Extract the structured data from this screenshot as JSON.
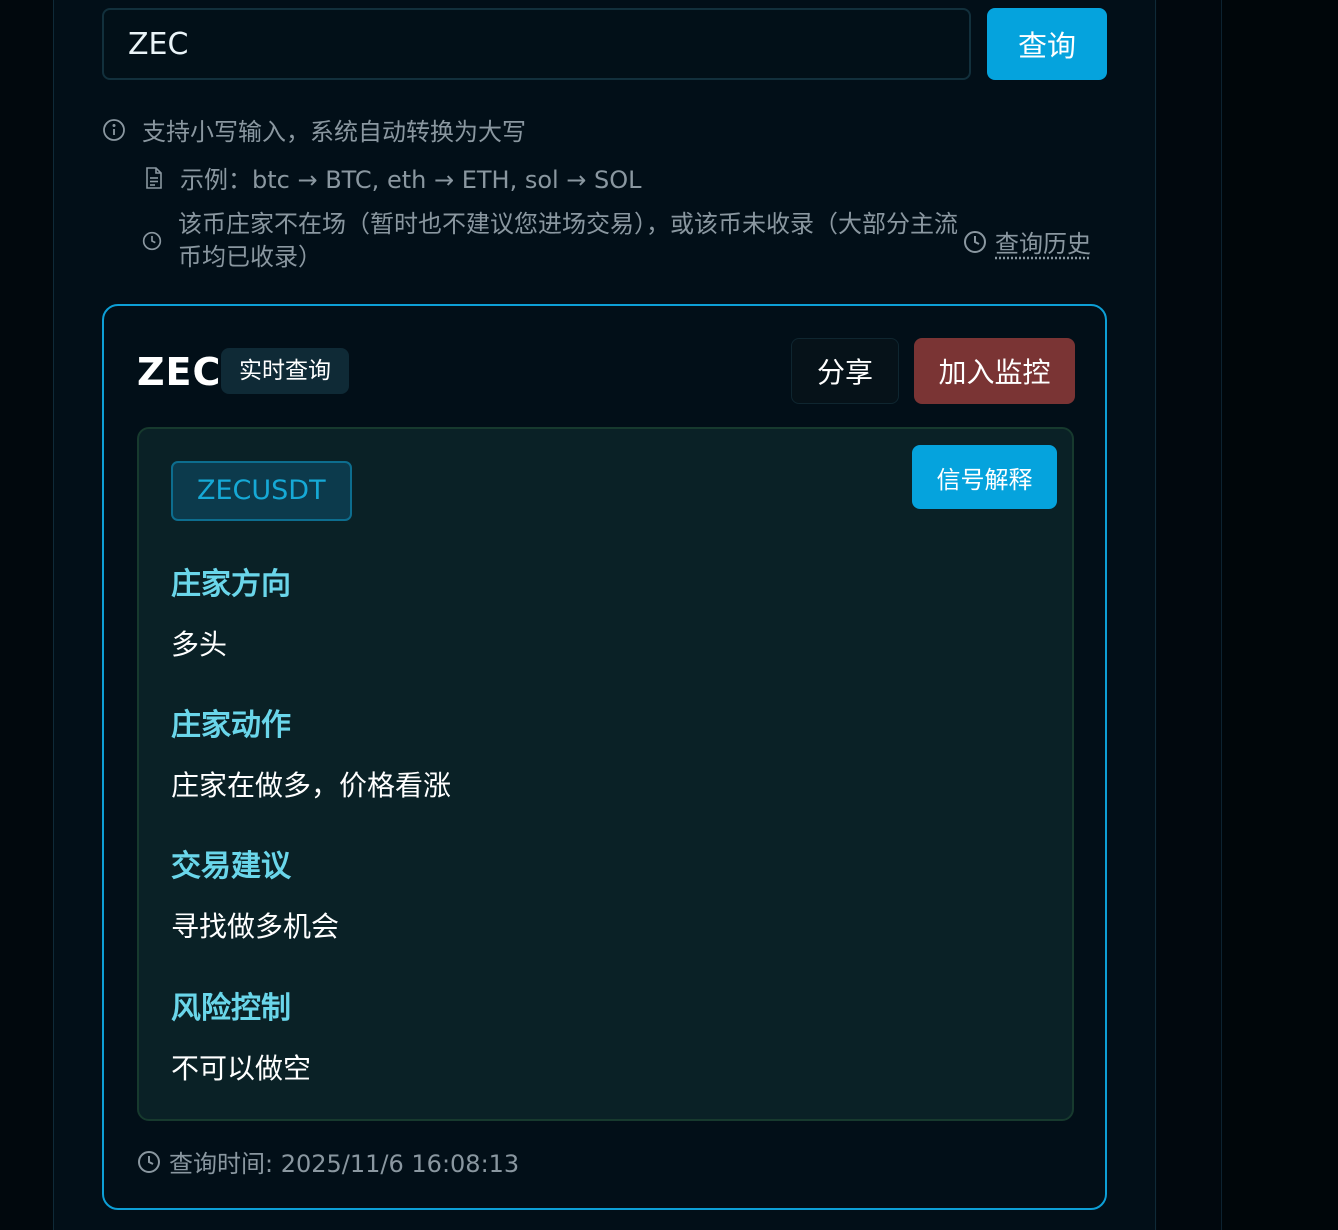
{
  "search": {
    "value": "ZEC",
    "button_label": "查询"
  },
  "tips": {
    "lowercase": "支持小写输入，系统自动转换为大写",
    "example": "示例：btc → BTC, eth → ETH, sol → SOL",
    "not_listed": "该币庄家不在场（暂时也不建议您进场交易），或该币未收录（大部分主流币均已收录）",
    "history_link": "查询历史"
  },
  "result": {
    "symbol": "ZEC",
    "mode_badge": "实时查询",
    "share_label": "分享",
    "monitor_label": "加入监控",
    "pair": "ZECUSDT",
    "explain_label": "信号解释",
    "sections": [
      {
        "title": "庄家方向",
        "value": "多头"
      },
      {
        "title": "庄家动作",
        "value": "庄家在做多，价格看涨"
      },
      {
        "title": "交易建议",
        "value": "寻找做多机会"
      },
      {
        "title": "风险控制",
        "value": "不可以做空"
      }
    ],
    "query_time": "查询时间: 2025/11/6 16:08:13"
  },
  "colors": {
    "accent": "#05a3dd",
    "danger": "#7a3434",
    "section_title": "#6ad6ea",
    "card_border": "#0d9fd6"
  }
}
